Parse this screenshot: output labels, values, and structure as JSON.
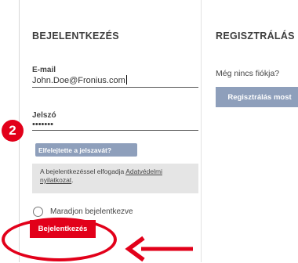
{
  "login": {
    "heading": "BEJELENTKEZÉS",
    "email_label": "E-mail",
    "email_value": "John.Doe@Fronius.com",
    "password_label": "Jelszó",
    "password_value": "•••••••",
    "forgot_label": "Elfelejtette a jelszavát?",
    "notice_text": "A bejelentkezéssel elfogadja",
    "notice_link": "Adatvédelmi nyilatkozat",
    "notice_end": ".",
    "remember_label": "Maradjon bejelentkezve",
    "submit_label": "Bejelentkezés"
  },
  "register": {
    "heading": "REGISZTRÁLÁS",
    "prompt": "Még nincs fiókja?",
    "button_label": "Regisztrálás most"
  },
  "annotation": {
    "step_number": "2",
    "accent_color": "#e2001a"
  }
}
